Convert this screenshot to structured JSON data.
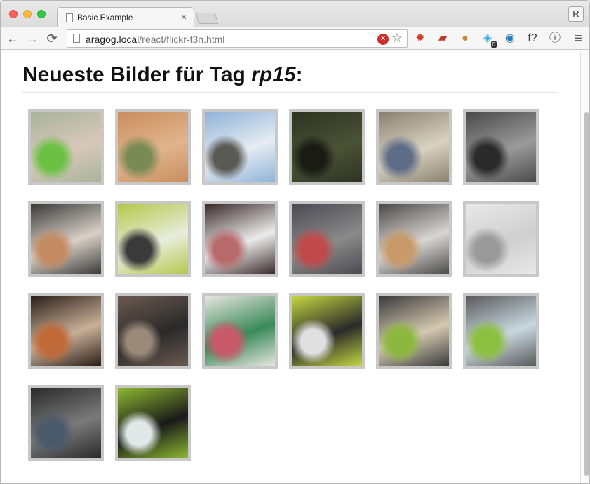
{
  "browser": {
    "tab_title": "Basic Example",
    "tab_close": "×",
    "profile_label": "R",
    "url_host": "aragog.local",
    "url_path": "/react/flickr-t3n.html",
    "nav_back": "←",
    "nav_forward": "→",
    "nav_reload": "⟳",
    "menu": "≡",
    "extensions": [
      {
        "icon": "gear-badge-icon",
        "glyph": "✹",
        "color": "#d23a2a"
      },
      {
        "icon": "couch-icon",
        "glyph": "▰",
        "color": "#c0392b"
      },
      {
        "icon": "cookie-icon",
        "glyph": "●",
        "color": "#c8893e"
      },
      {
        "icon": "ghost-icon",
        "glyph": "◈",
        "color": "#3aaee0",
        "badge": "0"
      },
      {
        "icon": "circle-app-icon",
        "glyph": "◉",
        "color": "#2c7bbf"
      },
      {
        "icon": "font-icon",
        "glyph": "f?",
        "color": "#333333"
      },
      {
        "icon": "info-icon",
        "glyph": "ⓘ",
        "color": "#444444"
      }
    ]
  },
  "page": {
    "heading_prefix": "Neueste Bilder für Tag ",
    "heading_tag": "rp15",
    "heading_suffix": ":"
  },
  "photos": [
    {
      "name": "photo-notes-shoes",
      "c1": "#a8b49a",
      "c2": "#d8c7bb",
      "c3": "#6bc242"
    },
    {
      "name": "photo-brick-wall",
      "c1": "#c98d5f",
      "c2": "#e0b48c",
      "c3": "#7a8a55"
    },
    {
      "name": "photo-airplane-wing",
      "c1": "#8fb2d8",
      "c2": "#e6ecf2",
      "c3": "#5a5a55"
    },
    {
      "name": "photo-dark-tent",
      "c1": "#2e3322",
      "c2": "#4a5236",
      "c3": "#1a1c14"
    },
    {
      "name": "photo-campbar",
      "c1": "#8a8070",
      "c2": "#d9d2c0",
      "c3": "#5f6e88"
    },
    {
      "name": "photo-glasses-table",
      "c1": "#4a4a4a",
      "c2": "#9a9a9a",
      "c3": "#2a2a2a"
    },
    {
      "name": "photo-drawing-woman",
      "c1": "#3a3a3a",
      "c2": "#d8d0c6",
      "c3": "#c48a62"
    },
    {
      "name": "photo-green-booth",
      "c1": "#b4c84a",
      "c2": "#e8ecdc",
      "c3": "#3a3a3a"
    },
    {
      "name": "photo-screen-post",
      "c1": "#3a2a2a",
      "c2": "#ececec",
      "c3": "#b86a6a"
    },
    {
      "name": "photo-group-people",
      "c1": "#4a4a52",
      "c2": "#8a8a8a",
      "c3": "#c04a4a"
    },
    {
      "name": "photo-artist-desk",
      "c1": "#4a4a4a",
      "c2": "#d8d6d2",
      "c3": "#c89a6a"
    },
    {
      "name": "photo-sketch-lattice",
      "c1": "#e8e8e8",
      "c2": "#cfcfcf",
      "c3": "#9a9a9a"
    },
    {
      "name": "photo-bottle",
      "c1": "#2a1e18",
      "c2": "#c8b098",
      "c3": "#c06a3a"
    },
    {
      "name": "photo-men-tablet",
      "c1": "#6a5a50",
      "c2": "#2a2a2a",
      "c3": "#9a8a7a"
    },
    {
      "name": "photo-stickers-hand",
      "c1": "#e8e6e0",
      "c2": "#3a8a5a",
      "c3": "#c85a6a"
    },
    {
      "name": "photo-green-screen",
      "c1": "#c4d840",
      "c2": "#2a2a2a",
      "c3": "#e0e0e0"
    },
    {
      "name": "photo-two-women",
      "c1": "#3a3a3a",
      "c2": "#d4c8b0",
      "c3": "#8cb840"
    },
    {
      "name": "photo-rp15-crowd",
      "c1": "#5a5a5a",
      "c2": "#c8d8e0",
      "c3": "#8cc040"
    },
    {
      "name": "photo-chalkboard",
      "c1": "#2a2a2a",
      "c2": "#7a7a7a",
      "c3": "#4a5a6a"
    },
    {
      "name": "photo-monitor-wall",
      "c1": "#8cb830",
      "c2": "#1a1a1a",
      "c3": "#e0e8e8"
    }
  ]
}
